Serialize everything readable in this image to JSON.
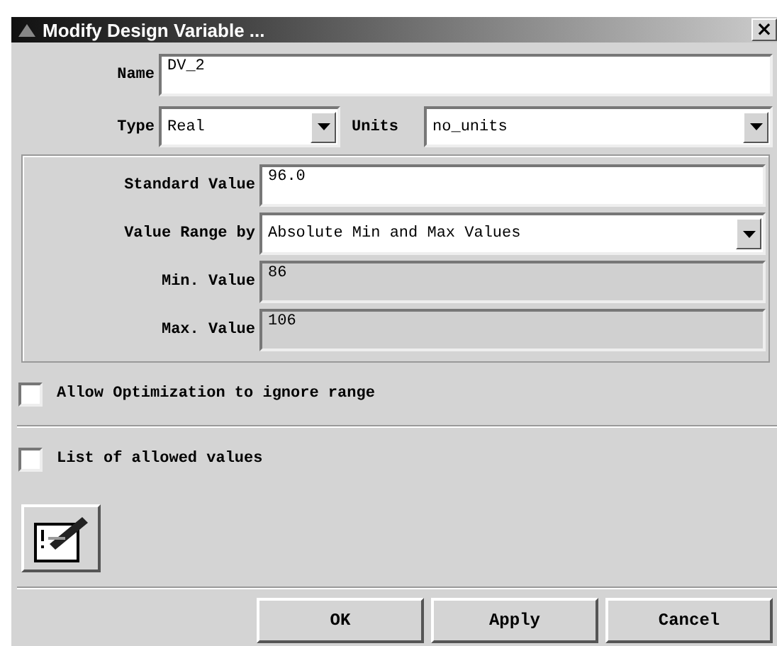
{
  "window": {
    "title": "Modify Design Variable ...",
    "close": "×"
  },
  "name_field": {
    "label": "Name",
    "value": "DV_2"
  },
  "type_field": {
    "label": "Type",
    "value": "Real"
  },
  "units_field": {
    "label": "Units",
    "value": "no_units"
  },
  "range_group": {
    "fields": [
      {
        "kind": "text",
        "label": "Standard Value",
        "value": "96.0",
        "disabled": false
      },
      {
        "kind": "dropdown",
        "label": "Value Range by",
        "value": "Absolute Min and Max Values",
        "disabled": false
      },
      {
        "kind": "text",
        "label": "Min. Value",
        "value": "86",
        "disabled": true
      },
      {
        "kind": "text",
        "label": "Max. Value",
        "value": "106",
        "disabled": true
      }
    ]
  },
  "options": [
    {
      "label": "Allow Optimization to ignore range",
      "checked": false
    },
    {
      "label": "List of allowed values",
      "checked": false
    }
  ],
  "buttons": [
    "OK",
    "Apply",
    "Cancel"
  ]
}
